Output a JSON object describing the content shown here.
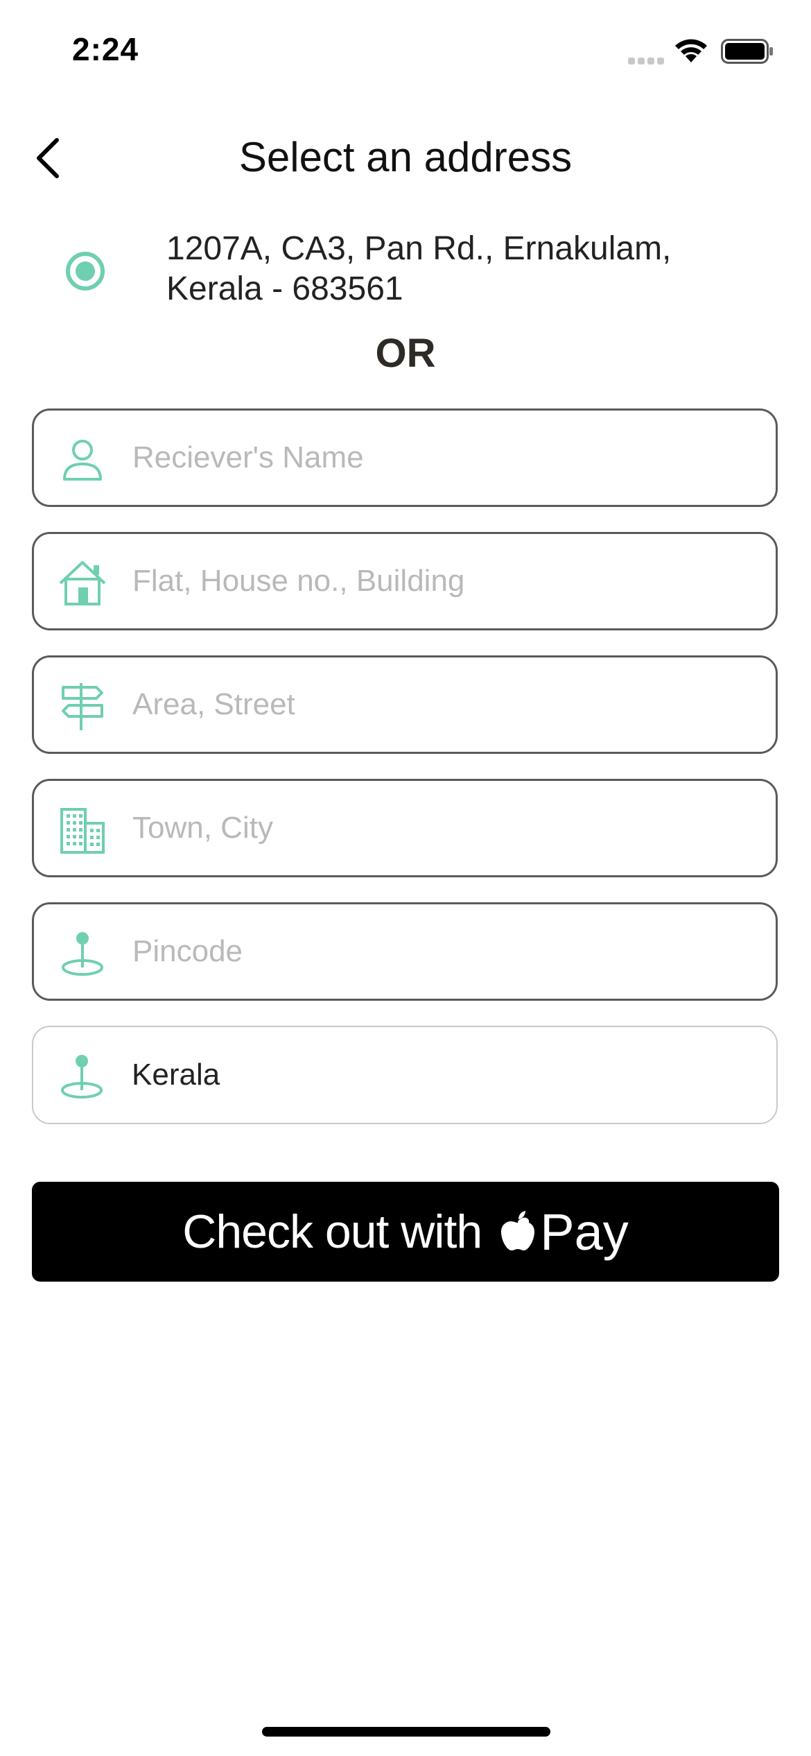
{
  "status_bar": {
    "time": "2:24"
  },
  "header": {
    "title": "Select an address"
  },
  "saved_address": {
    "line1": "1207A, CA3, Pan Rd., Ernakulam,",
    "line2": "Kerala - 683561"
  },
  "or_label": "OR",
  "form": {
    "receiver_name": {
      "placeholder": "Reciever's Name",
      "value": ""
    },
    "flat_house": {
      "placeholder": "Flat, House no., Building",
      "value": ""
    },
    "area_street": {
      "placeholder": "Area, Street",
      "value": ""
    },
    "town_city": {
      "placeholder": "Town, City",
      "value": ""
    },
    "pincode": {
      "placeholder": "Pincode",
      "value": ""
    },
    "state": {
      "value": "Kerala"
    }
  },
  "pay_button": {
    "label": "Check out with",
    "brand": "Pay"
  },
  "colors": {
    "accent": "#6fcfb0",
    "button_bg": "#000000",
    "placeholder": "#b9b9b9"
  }
}
